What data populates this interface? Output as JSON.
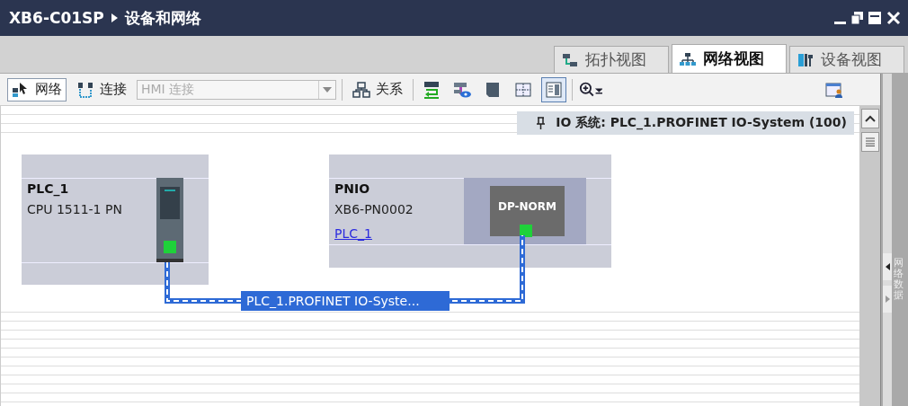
{
  "window": {
    "project": "XB6-C01SP",
    "title": "设备和网络"
  },
  "tabs": [
    {
      "label": "拓扑视图",
      "kind": "topology",
      "selected": false
    },
    {
      "label": "网络视图",
      "kind": "network",
      "selected": true
    },
    {
      "label": "设备视图",
      "kind": "device",
      "selected": false
    }
  ],
  "toolbar": {
    "modes": [
      {
        "label": "网络",
        "kind": "network",
        "selected": true
      },
      {
        "label": "连接",
        "kind": "connect",
        "selected": false
      }
    ],
    "connection_type": {
      "value": "HMI 连接",
      "disabled": true
    },
    "relations": {
      "label": "关系"
    },
    "view_buttons": [
      {
        "kind": "name",
        "selected": false
      },
      {
        "kind": "eye",
        "selected": false
      },
      {
        "kind": "page",
        "selected": false
      },
      {
        "kind": "grid",
        "selected": false
      },
      {
        "kind": "list",
        "selected": true
      }
    ]
  },
  "io_system_pin": {
    "label": "IO 系统: PLC_1.PROFINET IO-System (100)"
  },
  "nodes": [
    {
      "kind": "plc",
      "name": "PLC_1",
      "type": "CPU 1511-1 PN"
    },
    {
      "kind": "io_device",
      "name": "PNIO",
      "type": "XB6-PN0002",
      "link": "PLC_1",
      "module": "DP-NORM"
    }
  ],
  "network": {
    "label": "PLC_1.PROFINET IO-Syste..."
  },
  "side_panel": {
    "label": "网络数据"
  }
}
